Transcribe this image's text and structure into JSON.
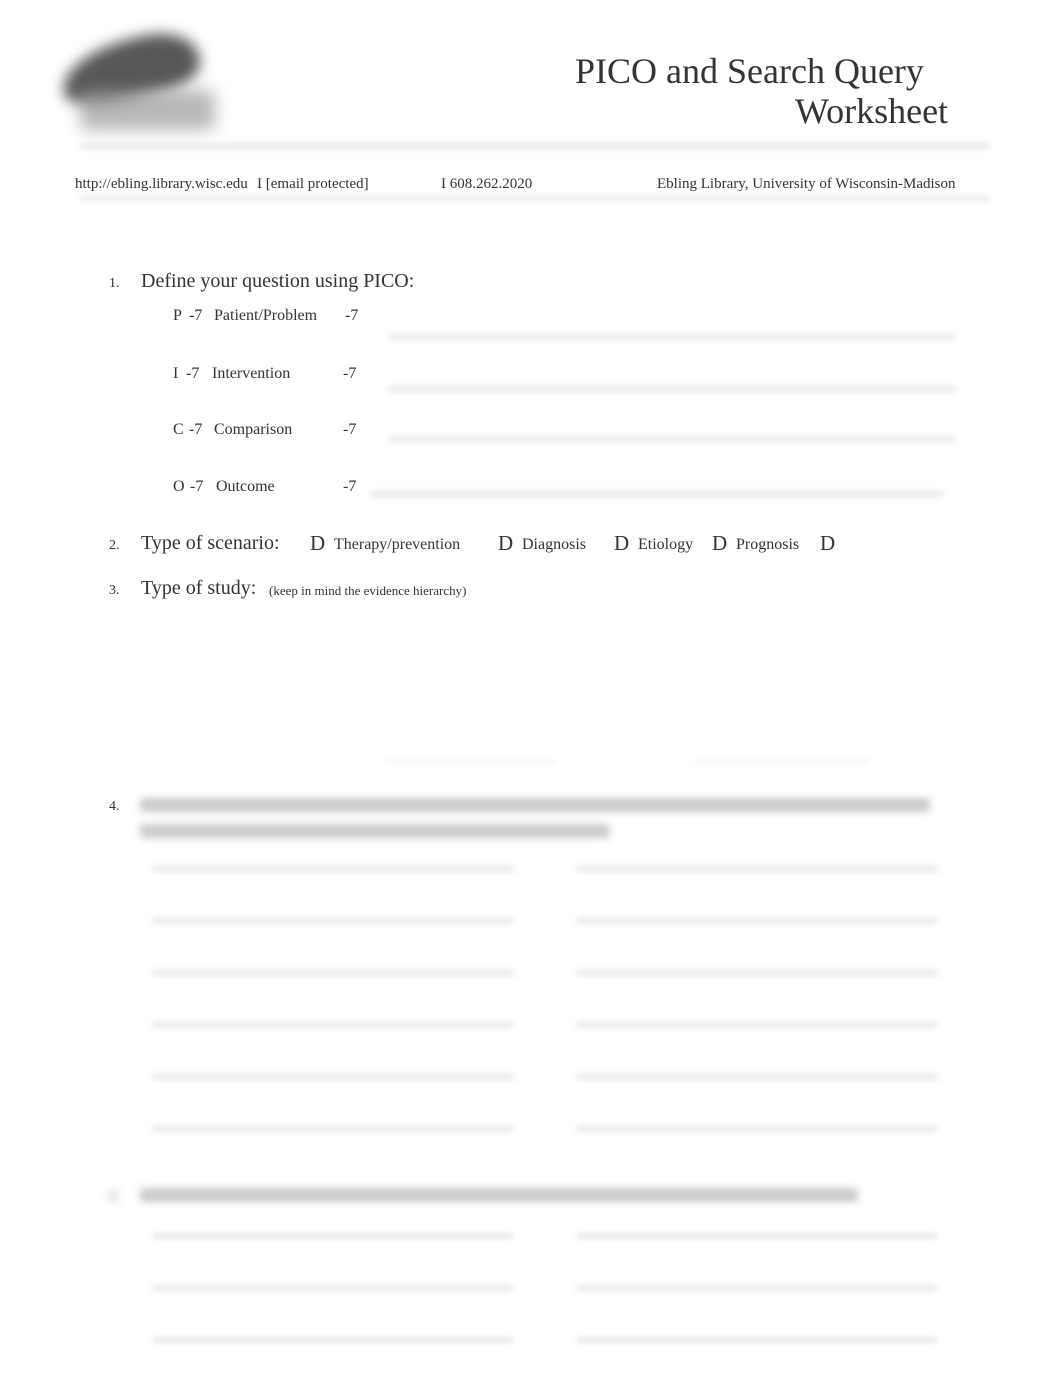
{
  "header": {
    "logo_label": "Ebling Library logo",
    "title_line1": "PICO and Search Query",
    "title_line2": "Worksheet",
    "contact": {
      "url": "http://ebling.library.wisc.edu",
      "email": "I [email protected]",
      "phone": "I 608.262.2020",
      "institution": "Ebling Library, University of Wisconsin-Madison"
    }
  },
  "sections": {
    "q1": {
      "number": "1.",
      "heading": "Define your question using PICO:",
      "rows": [
        {
          "letter": "P",
          "sep": "-7",
          "label": "Patient/Problem",
          "arrow": "-7"
        },
        {
          "letter": "I",
          "sep": "-7",
          "label": "Intervention",
          "arrow": "-7"
        },
        {
          "letter": "C",
          "sep": "-7",
          "label": "Comparison",
          "arrow": "-7"
        },
        {
          "letter": "O",
          "sep": "-7",
          "label": "Outcome",
          "arrow": "-7"
        }
      ]
    },
    "q2": {
      "number": "2.",
      "heading": "Type of scenario:",
      "checkbox_glyph": "D",
      "options": [
        "Therapy/prevention",
        "Diagnosis",
        "Etiology",
        "Prognosis",
        ""
      ]
    },
    "q3": {
      "number": "3.",
      "heading": "Type of study:",
      "note": "(keep in mind the evidence hierarchy)"
    },
    "q4": {
      "number": "4.",
      "heading": "[blurred text]",
      "blank_lines": 12
    },
    "q5": {
      "number": "5.",
      "heading": "[blurred text]",
      "blank_lines": 6
    }
  }
}
